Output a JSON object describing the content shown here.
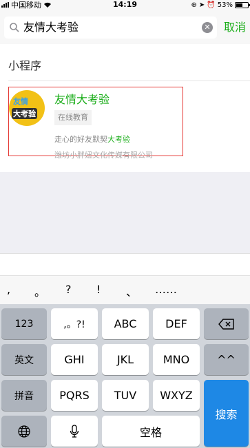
{
  "status_bar": {
    "carrier": "中国移动",
    "time": "14:19",
    "battery": "53%"
  },
  "search": {
    "query": "友情大考验",
    "clear_icon": "clear-icon",
    "cancel_label": "取消"
  },
  "results": {
    "section_label": "小程序",
    "card": {
      "avatar_text_top": "友情",
      "avatar_text_bottom": "大考验",
      "name": "友情大考验",
      "tag": "在线教育",
      "description_prefix": "走心的好友默契",
      "description_highlight": "大考验",
      "company": "潍坊小胖妞文化传媒有限公司"
    }
  },
  "keyboard": {
    "punctuation": [
      ",",
      "。",
      "?",
      "!",
      "、",
      "……"
    ],
    "row1": [
      "123",
      ",。?!",
      "ABC",
      "DEF"
    ],
    "row2": [
      "英文",
      "GHI",
      "JKL",
      "MNO",
      "^^"
    ],
    "row3": [
      "拼音",
      "PQRS",
      "TUV",
      "WXYZ"
    ],
    "row4": {
      "space": "空格"
    },
    "search_label": "搜索",
    "icons": {
      "delete": "backspace-icon",
      "globe": "globe-icon",
      "mic": "microphone-icon"
    }
  },
  "colors": {
    "accent": "#1aad19",
    "highlight_border": "#e53935",
    "search_key": "#1e88e5"
  }
}
